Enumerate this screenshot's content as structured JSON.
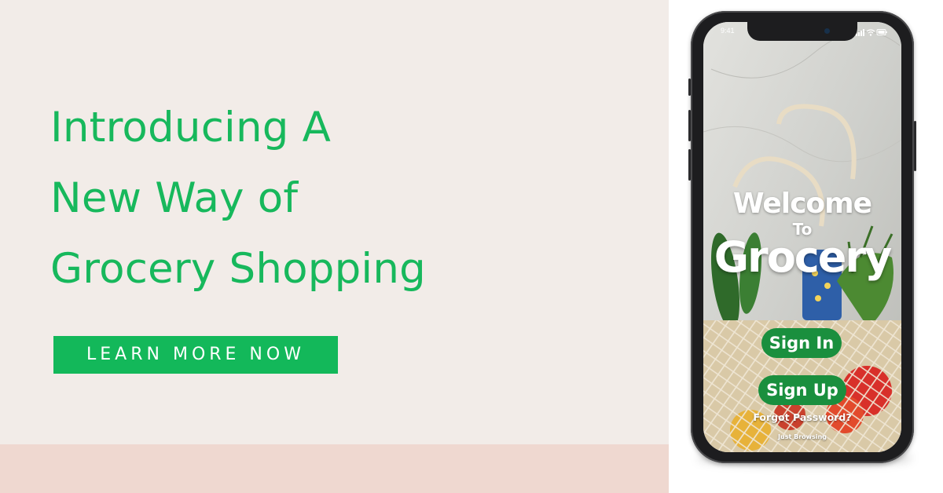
{
  "banner": {
    "headline_lines": [
      "Introducing A",
      "New Way of",
      "Grocery Shopping"
    ],
    "cta_label": "LEARN MORE NOW"
  },
  "phone": {
    "status_time": "9:41",
    "status_icons": [
      "signal-icon",
      "wifi-icon",
      "battery-icon"
    ],
    "welcome_line": "Welcome",
    "to_line": "To",
    "brand_name": "Grocery",
    "sign_in_label": "Sign In",
    "sign_up_label": "Sign Up",
    "forgot_password_label": "Forgot Password?",
    "just_browsing_label": "Just Browsing"
  },
  "colors": {
    "brand_green": "#17b85c",
    "app_button_green": "#1a8f3e",
    "panel_background": "#f2ece8",
    "bottom_band": "#efd8d0"
  }
}
